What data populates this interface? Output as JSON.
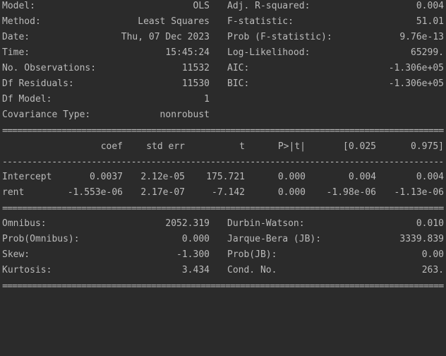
{
  "rules": {
    "double": "================================================================================================",
    "single": "------------------------------------------------------------------------------------------------"
  },
  "header_left": [
    {
      "label": "Model:",
      "value": "OLS"
    },
    {
      "label": "Method:",
      "value": "Least Squares"
    },
    {
      "label": "Date:",
      "value": "Thu, 07 Dec 2023"
    },
    {
      "label": "Time:",
      "value": "15:45:24"
    },
    {
      "label": "No. Observations:",
      "value": "11532"
    },
    {
      "label": "Df Residuals:",
      "value": "11530"
    },
    {
      "label": "Df Model:",
      "value": "1"
    },
    {
      "label": "Covariance Type:",
      "value": "nonrobust"
    }
  ],
  "header_right": [
    {
      "label": "Adj. R-squared:",
      "value": "0.004"
    },
    {
      "label": "F-statistic:",
      "value": "51.01"
    },
    {
      "label": "Prob (F-statistic):",
      "value": "9.76e-13"
    },
    {
      "label": "Log-Likelihood:",
      "value": "65299."
    },
    {
      "label": "AIC:",
      "value": "-1.306e+05"
    },
    {
      "label": "BIC:",
      "value": "-1.306e+05"
    }
  ],
  "coef_table": {
    "columns": [
      "coef",
      "std err",
      "t",
      "P>|t|",
      "[0.025",
      "0.975]"
    ],
    "rows": [
      {
        "name": "Intercept",
        "values": [
          "0.0037",
          "2.12e-05",
          "175.721",
          "0.000",
          "0.004",
          "0.004"
        ]
      },
      {
        "name": "rent",
        "values": [
          "-1.553e-06",
          "2.17e-07",
          "-7.142",
          "0.000",
          "-1.98e-06",
          "-1.13e-06"
        ]
      }
    ]
  },
  "diag_left": [
    {
      "label": "Omnibus:",
      "value": "2052.319"
    },
    {
      "label": "Prob(Omnibus):",
      "value": "0.000"
    },
    {
      "label": "Skew:",
      "value": "-1.300"
    },
    {
      "label": "Kurtosis:",
      "value": "3.434"
    }
  ],
  "diag_right": [
    {
      "label": "Durbin-Watson:",
      "value": "0.010"
    },
    {
      "label": "Jarque-Bera (JB):",
      "value": "3339.839"
    },
    {
      "label": "Prob(JB):",
      "value": "0.00"
    },
    {
      "label": "Cond. No.",
      "value": "263."
    }
  ]
}
